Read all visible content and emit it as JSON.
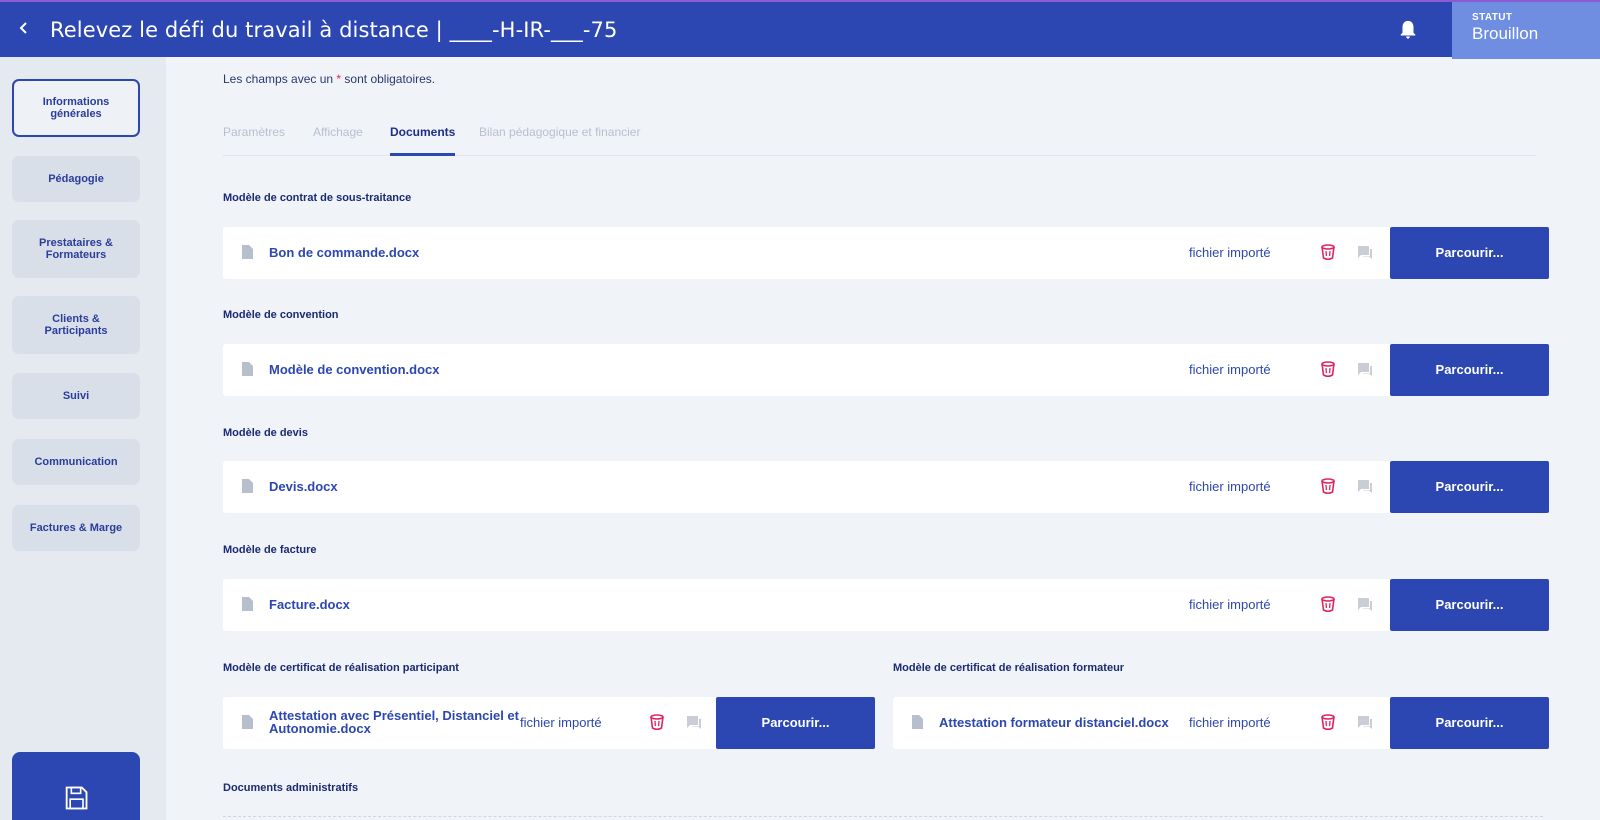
{
  "header": {
    "back_icon": "chevron-left-icon",
    "title": "Relevez le défi du travail à distance | ____-H-IR-___-75",
    "status_label": "STATUT",
    "status_value": "Brouillon"
  },
  "sidebar": {
    "items": [
      {
        "label": "Informations générales",
        "active": true
      },
      {
        "label": "Pédagogie",
        "active": false
      },
      {
        "label": "Prestataires & Formateurs",
        "active": false
      },
      {
        "label": "Clients & Participants",
        "active": false
      },
      {
        "label": "Suivi",
        "active": false
      },
      {
        "label": "Communication",
        "active": false
      },
      {
        "label": "Factures & Marge",
        "active": false
      }
    ],
    "save_icon": "floppy-disk-icon"
  },
  "main": {
    "required_note_prefix": "Les champs avec un",
    "required_star": "*",
    "required_note_suffix": "sont obligatoires.",
    "tabs": [
      {
        "label": "Paramètres",
        "active": false
      },
      {
        "label": "Affichage",
        "active": false
      },
      {
        "label": "Documents",
        "active": true
      },
      {
        "label": "Bilan pédagogique et financier",
        "active": false
      }
    ],
    "sections": [
      {
        "label": "Modèle de contrat de sous-traitance",
        "file": "Bon de commande.docx",
        "imported": "fichier importé",
        "browse": "Parcourir..."
      },
      {
        "label": "Modèle de convention",
        "file": "Modèle de convention.docx",
        "imported": "fichier importé",
        "browse": "Parcourir..."
      },
      {
        "label": "Modèle de devis",
        "file": "Devis.docx",
        "imported": "fichier importé",
        "browse": "Parcourir..."
      },
      {
        "label": "Modèle de facture",
        "file": "Facture.docx",
        "imported": "fichier importé",
        "browse": "Parcourir..."
      }
    ],
    "cert_participant": {
      "label": "Modèle de certificat de réalisation participant",
      "file_line1": "Attestation avec Présentiel, Distanciel et",
      "file_line2": "Autonomie.docx",
      "imported": "fichier importé",
      "browse": "Parcourir..."
    },
    "cert_trainer": {
      "label": "Modèle de certificat de réalisation formateur",
      "file": "Attestation formateur distanciel.docx",
      "imported": "fichier importé",
      "browse": "Parcourir..."
    },
    "admin_label": "Documents administratifs"
  },
  "colors": {
    "primary": "#2c47b1",
    "status_bg": "#6f8ee2",
    "delete": "#e0245e",
    "page_bg": "#f0f3f7"
  }
}
